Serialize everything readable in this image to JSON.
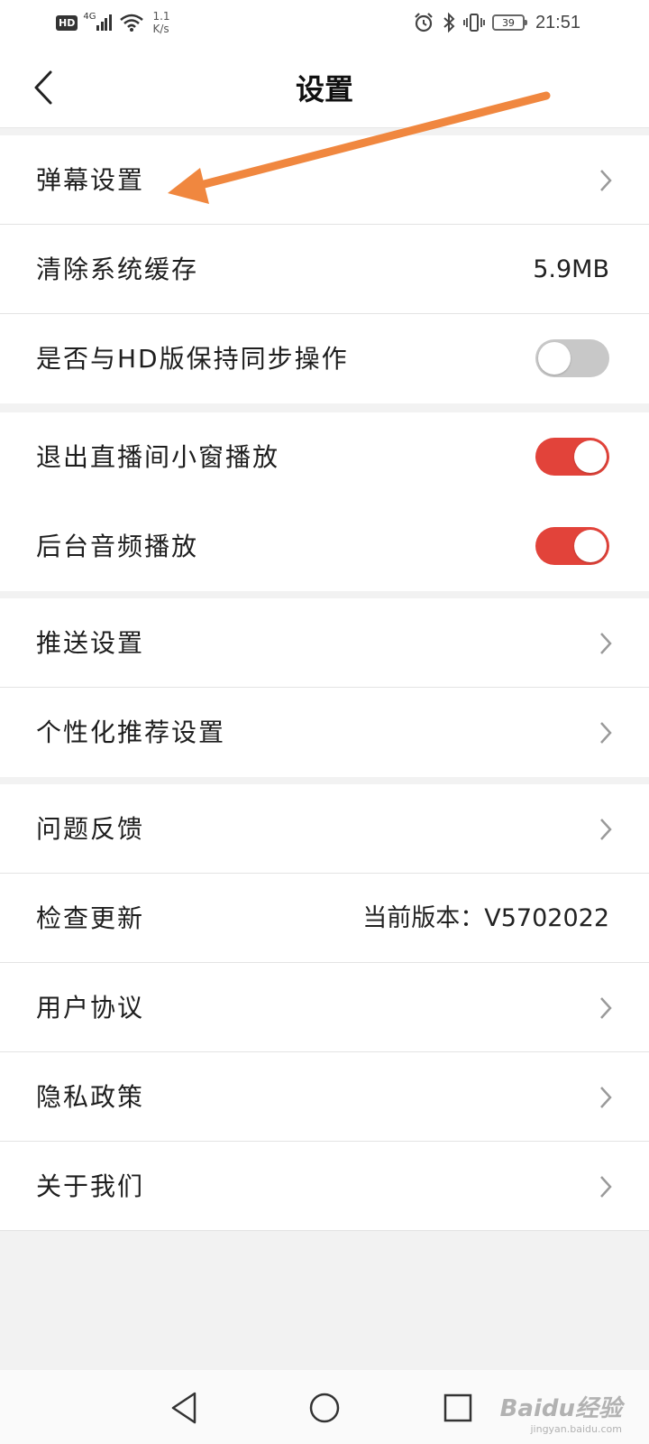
{
  "status_bar": {
    "network_badge": "HD",
    "network_type": "4G",
    "speed": "1.1",
    "speed_unit": "K/s",
    "battery": "39",
    "time": "21:51"
  },
  "header": {
    "title": "设置"
  },
  "groups": [
    {
      "rows": [
        {
          "label": "弹幕设置",
          "type": "link"
        },
        {
          "label": "清除系统缓存",
          "type": "value",
          "value": "5.9MB"
        },
        {
          "label": "是否与HD版保持同步操作",
          "type": "toggle",
          "on": false
        }
      ]
    },
    {
      "rows": [
        {
          "label": "退出直播间小窗播放",
          "type": "toggle",
          "on": true
        },
        {
          "label": "后台音频播放",
          "type": "toggle",
          "on": true
        }
      ]
    },
    {
      "rows": [
        {
          "label": "推送设置",
          "type": "link"
        },
        {
          "label": "个性化推荐设置",
          "type": "link"
        }
      ]
    },
    {
      "rows": [
        {
          "label": "问题反馈",
          "type": "link"
        },
        {
          "label": "检查更新",
          "type": "value",
          "value": "当前版本：V5702022"
        },
        {
          "label": "用户协议",
          "type": "link"
        },
        {
          "label": "隐私政策",
          "type": "link"
        },
        {
          "label": "关于我们",
          "type": "link"
        }
      ]
    }
  ],
  "watermark": {
    "brand": "Baidu经验",
    "url": "jingyan.baidu.com"
  },
  "colors": {
    "toggle_on": "#e2433a",
    "toggle_off": "#c8c8c8",
    "annotation_arrow": "#f0873f"
  }
}
